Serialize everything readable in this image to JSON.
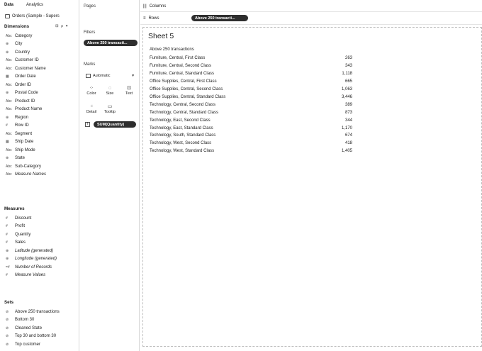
{
  "data_pane": {
    "tabs": [
      "Data",
      "Analytics"
    ],
    "data_source": "Orders (Sample - Supers",
    "dimensions_title": "Dimensions",
    "dimensions_tools": "⊞ ρ ▾",
    "dimensions": [
      {
        "icon": "Abc",
        "label": "Category"
      },
      {
        "icon": "⊕",
        "label": "City"
      },
      {
        "icon": "⊕",
        "label": "Country"
      },
      {
        "icon": "Abc",
        "label": "Customer ID"
      },
      {
        "icon": "Abc",
        "label": "Customer Name"
      },
      {
        "icon": "▦",
        "label": "Order Date"
      },
      {
        "icon": "Abc",
        "label": "Order ID"
      },
      {
        "icon": "⊕",
        "label": "Postal Code"
      },
      {
        "icon": "Abc",
        "label": "Product ID"
      },
      {
        "icon": "Abc",
        "label": "Product Name"
      },
      {
        "icon": "⊕",
        "label": "Region"
      },
      {
        "icon": "#",
        "label": "Row ID"
      },
      {
        "icon": "Abc",
        "label": "Segment"
      },
      {
        "icon": "▦",
        "label": "Ship Date"
      },
      {
        "icon": "Abc",
        "label": "Ship Mode"
      },
      {
        "icon": "⊕",
        "label": "State"
      },
      {
        "icon": "Abc",
        "label": "Sub-Category"
      },
      {
        "icon": "Abc",
        "label": "Measure Names",
        "italic": true
      }
    ],
    "measures_title": "Measures",
    "measures": [
      {
        "icon": "#",
        "label": "Discount"
      },
      {
        "icon": "#",
        "label": "Profit"
      },
      {
        "icon": "#",
        "label": "Quantity"
      },
      {
        "icon": "#",
        "label": "Sales"
      },
      {
        "icon": "⊕",
        "label": "Latitude (generated)",
        "italic": true
      },
      {
        "icon": "⊕",
        "label": "Longitude (generated)",
        "italic": true
      },
      {
        "icon": "=#",
        "label": "Number of Records",
        "italic": true
      },
      {
        "icon": "#",
        "label": "Measure Values",
        "italic": true
      }
    ],
    "sets_title": "Sets",
    "sets": [
      {
        "icon": "⊘",
        "label": "Above 250 transactions"
      },
      {
        "icon": "⊘",
        "label": "Bottom 30"
      },
      {
        "icon": "⊘",
        "label": "Cleaned State"
      },
      {
        "icon": "⊘",
        "label": "Top 30 and bottom 30"
      },
      {
        "icon": "⊘",
        "label": "Top customer"
      }
    ]
  },
  "cards": {
    "pages_title": "Pages",
    "filters_title": "Filters",
    "filter_pill": "Above 250 transacti...",
    "marks_title": "Marks",
    "mark_type": "Automatic",
    "mark_buttons": [
      {
        "glyph": "⁘",
        "label": "Color"
      },
      {
        "glyph": "◌",
        "label": "Size"
      },
      {
        "glyph": "⊡",
        "label": "Text"
      },
      {
        "glyph": "⁖",
        "label": "Detail"
      },
      {
        "glyph": "▭",
        "label": "Tooltip"
      }
    ],
    "marks_pill_icon": "T",
    "marks_pill": "SUM(Quantity)"
  },
  "shelves": {
    "columns_icon": "|||",
    "columns_label": "Columns",
    "rows_icon": "≡",
    "rows_label": "Rows",
    "rows_pill": "Above 250 transacti..."
  },
  "sheet": {
    "title": "Sheet 5",
    "header": "Above 250 transactions",
    "rows": [
      {
        "label": "Furniture, Central, First Class",
        "value": "263"
      },
      {
        "label": "Furniture, Central, Second Class",
        "value": "343"
      },
      {
        "label": "Furniture, Central, Standard Class",
        "value": "1,118"
      },
      {
        "label": "Office Supplies, Central, First Class",
        "value": "665"
      },
      {
        "label": "Office Supplies, Central, Second Class",
        "value": "1,063"
      },
      {
        "label": "Office Supplies, Central, Standard Class",
        "value": "3,446"
      },
      {
        "label": "Technology, Central, Second Class",
        "value": "389"
      },
      {
        "label": "Technology, Central, Standard Class",
        "value": "873"
      },
      {
        "label": "Technology, East, Second Class",
        "value": "344"
      },
      {
        "label": "Technology, East, Standard Class",
        "value": "1,170"
      },
      {
        "label": "Technology, South, Standard Class",
        "value": "674"
      },
      {
        "label": "Technology, West, Second Class",
        "value": "418"
      },
      {
        "label": "Technology, West, Standard Class",
        "value": "1,405"
      }
    ]
  }
}
